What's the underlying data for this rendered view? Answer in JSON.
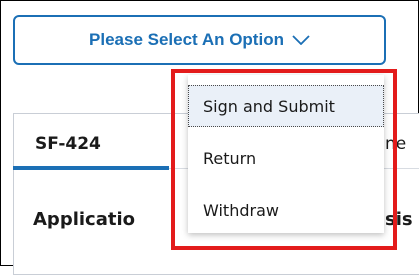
{
  "select_button": {
    "label": "Please Select An Option",
    "icon": "chevron-down-icon"
  },
  "tab": {
    "label": "SF-424",
    "partial_next_label": "ne"
  },
  "section": {
    "heading_partial": "Applicatio",
    "heading_right_partial": "sis"
  },
  "dropdown": {
    "items": [
      {
        "label": "Sign and Submit"
      },
      {
        "label": "Return"
      },
      {
        "label": "Withdraw"
      }
    ]
  },
  "colors": {
    "accent": "#1b6fb5",
    "highlight": "#e31b1b",
    "active_item_bg": "#eaf0f8"
  }
}
